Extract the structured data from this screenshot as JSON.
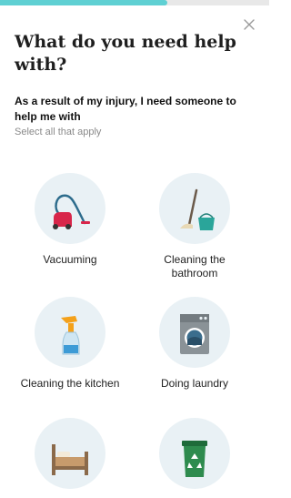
{
  "progress": {
    "fraction": 0.62
  },
  "close": {
    "icon": "close-icon"
  },
  "header": {
    "title": "What do you need help with?"
  },
  "prompt": {
    "question": "As a result of my injury, I need someone to help me with",
    "hint": "Select all that apply"
  },
  "options": [
    {
      "label": "Vacuuming",
      "icon": "vacuum-icon"
    },
    {
      "label": "Cleaning the bathroom",
      "icon": "mop-bucket-icon"
    },
    {
      "label": "Cleaning the kitchen",
      "icon": "spray-bottle-icon"
    },
    {
      "label": "Doing laundry",
      "icon": "washing-machine-icon"
    },
    {
      "label": "",
      "icon": "bed-icon"
    },
    {
      "label": "",
      "icon": "recycling-bin-icon"
    }
  ],
  "colors": {
    "accent": "#5fd0d3",
    "circle": "#e9f1f5",
    "track": "#e8e8e8"
  }
}
